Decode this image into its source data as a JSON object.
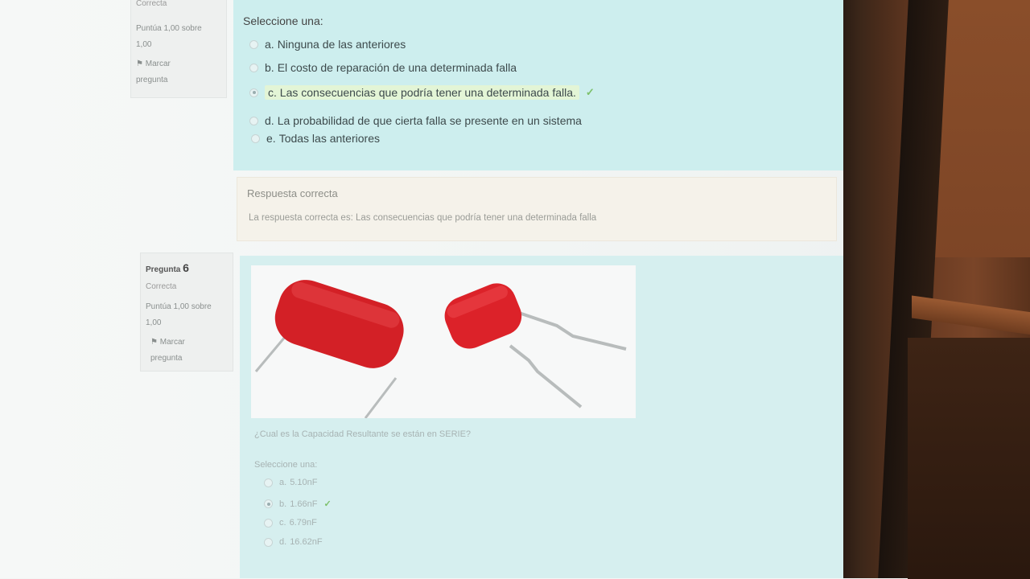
{
  "question5": {
    "status": "Correcta",
    "grade_line1": "Puntúa 1,00 sobre",
    "grade_line2": "1,00",
    "flag_line1": "Marcar",
    "flag_line2": "pregunta",
    "select_prompt": "Seleccione una:",
    "options": [
      {
        "letter": "a.",
        "text": "Ninguna de las anteriores",
        "selected": false,
        "correct": false
      },
      {
        "letter": "b.",
        "text": "El costo de reparación de una determinada falla",
        "selected": false,
        "correct": false
      },
      {
        "letter": "c.",
        "text": "Las consecuencias que podría tener una determinada falla.",
        "selected": true,
        "correct": true
      },
      {
        "letter": "d.",
        "text": "La probabilidad de que cierta falla se presente en un sistema",
        "selected": false,
        "correct": false
      },
      {
        "letter": "e.",
        "text": "Todas las anteriores",
        "selected": false,
        "correct": false
      }
    ],
    "feedback_title": "Respuesta correcta",
    "feedback_text": "La respuesta correcta es: Las consecuencias que podría tener una determinada falla"
  },
  "question6": {
    "label": "Pregunta",
    "number": "6",
    "status": "Correcta",
    "grade_line1": "Puntúa 1,00 sobre",
    "grade_line2": "1,00",
    "flag_line1": "Marcar",
    "flag_line2": "pregunta",
    "question_text": "¿Cual es la Capacidad Resultante se están en SERIE?",
    "select_prompt": "Seleccione una:",
    "options": [
      {
        "letter": "a.",
        "text": "5.10nF",
        "selected": false,
        "correct": false
      },
      {
        "letter": "b.",
        "text": "1.66nF",
        "selected": true,
        "correct": true
      },
      {
        "letter": "c.",
        "text": "6.79nF",
        "selected": false,
        "correct": false
      },
      {
        "letter": "d.",
        "text": "16.62nF",
        "selected": false,
        "correct": false
      }
    ]
  },
  "icons": {
    "flag": "flag-icon",
    "check": "check-icon"
  },
  "colors": {
    "question_bg": "#cdeeee",
    "feedback_bg": "#f5f2ea",
    "check": "#7cc06a",
    "capacitor": "#d9232a"
  }
}
